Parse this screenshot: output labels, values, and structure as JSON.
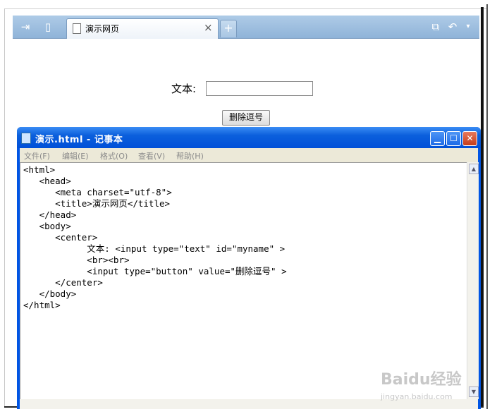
{
  "browser": {
    "tab_title": "演示网页",
    "tab_close": "×",
    "new_tab": "+",
    "form": {
      "label": "文本:",
      "input_value": "",
      "button_label": "删除逗号"
    }
  },
  "notepad": {
    "title": "演示.html - 记事本",
    "menu": [
      "文件(F)",
      "编辑(E)",
      "格式(O)",
      "查看(V)",
      "帮助(H)"
    ],
    "code": "<html>\n   <head>\n      <meta charset=\"utf-8\">\n      <title>演示网页</title>\n   </head>\n   <body>\n      <center>\n            文本: <input type=\"text\" id=\"myname\" >\n            <br><br>\n            <input type=\"button\" value=\"删除逗号\" >\n      </center>\n   </body>\n</html>"
  },
  "watermark": {
    "logo": "Baidu经验",
    "url": "jingyan.baidu.com"
  },
  "colors": {
    "tabbar": "#9fc0e2",
    "notepad_title": "#0b5fdc",
    "close_button": "#c43d1a"
  }
}
